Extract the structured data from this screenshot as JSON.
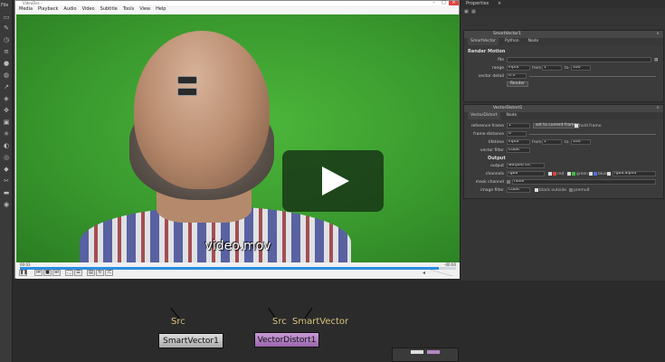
{
  "toolbar": {
    "file_label": "File"
  },
  "player": {
    "title": "VideoDec - ",
    "menu": [
      "Media",
      "Playback",
      "Audio",
      "Video",
      "Subtitle",
      "Tools",
      "View",
      "Help"
    ],
    "subtitle": "video.mov",
    "time_elapsed": "00:03",
    "time_remaining": "-00:00",
    "progress": 0.96
  },
  "properties": {
    "title": "Properties",
    "smartvector": {
      "name": "SmartVector1",
      "tabs": [
        "SmartVector",
        "Python",
        "Node"
      ],
      "section": "Render Motion",
      "file_label": "file",
      "range_label": "range",
      "range_value": "input",
      "from_label": "from",
      "from_value": "1",
      "to_label": "to",
      "to_value": "100",
      "vector_detail_label": "vector detail",
      "vector_detail_value": "0.3",
      "render_button": "Render"
    },
    "vectordistort": {
      "name": "VectorDistort1",
      "tabs": [
        "VectorDistort",
        "Node"
      ],
      "reference_frame_label": "reference frame",
      "reference_frame_value": "1",
      "set_current_button": "set to current frame",
      "hold_frame_label": "hold frame",
      "frame_distance_label": "frame distance",
      "frame_distance_value": "0",
      "lifetime_label": "lifetime",
      "lifetime_value": "input",
      "lifetime_from_label": "from",
      "lifetime_from_value": "1",
      "lifetime_to_label": "to",
      "lifetime_to_value": "100",
      "vector_filter_label": "vector filter",
      "vector_filter_value": "Cubic",
      "output_section": "Output",
      "output_label": "output",
      "output_value": "warped src",
      "channels_label": "channels",
      "channels_value": "rgba",
      "red_label": "red",
      "green_label": "green",
      "blue_label": "blue",
      "alpha_value": "rgba.alpha",
      "mask_channel_label": "mask channel",
      "mask_channel_value": "none",
      "image_filter_label": "image filter",
      "image_filter_value": "Cubic",
      "black_outside_label": "black outside",
      "premult_label": "premult"
    }
  },
  "nodegraph": {
    "node1": {
      "label": "SmartVector1",
      "input": "Src"
    },
    "node2": {
      "label": "VectorDistort1",
      "input1": "Src",
      "input2": "SmartVector"
    }
  }
}
